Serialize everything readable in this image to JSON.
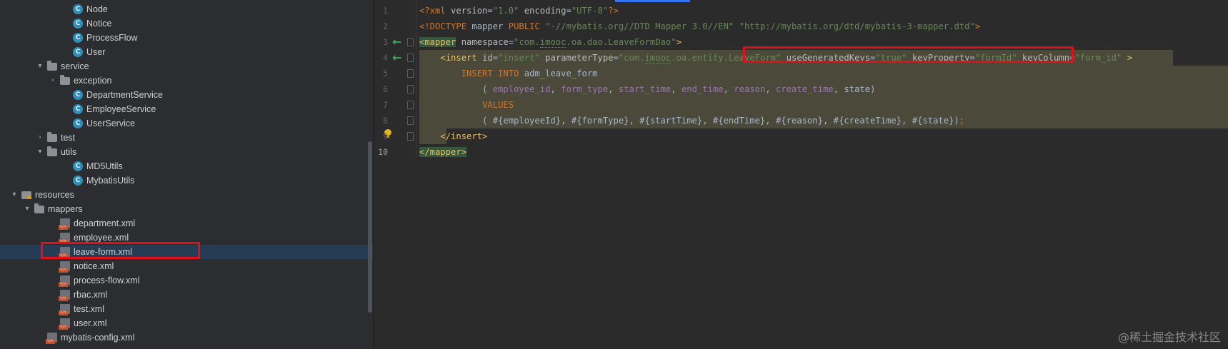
{
  "tree": {
    "items": [
      {
        "label": "Node",
        "type": "class",
        "indent": 5
      },
      {
        "label": "Notice",
        "type": "class",
        "indent": 5
      },
      {
        "label": "ProcessFlow",
        "type": "class",
        "indent": 5
      },
      {
        "label": "User",
        "type": "class",
        "indent": 5
      },
      {
        "label": "service",
        "type": "folder",
        "indent": 3,
        "expanded": true
      },
      {
        "label": "exception",
        "type": "folder",
        "indent": 4,
        "expanded": false
      },
      {
        "label": "DepartmentService",
        "type": "class",
        "indent": 5
      },
      {
        "label": "EmployeeService",
        "type": "class",
        "indent": 5
      },
      {
        "label": "UserService",
        "type": "class",
        "indent": 5
      },
      {
        "label": "test",
        "type": "folder",
        "indent": 3,
        "expanded": false
      },
      {
        "label": "utils",
        "type": "folder",
        "indent": 3,
        "expanded": true
      },
      {
        "label": "MD5Utils",
        "type": "class",
        "indent": 5
      },
      {
        "label": "MybatisUtils",
        "type": "class",
        "indent": 5
      },
      {
        "label": "resources",
        "type": "resfolder",
        "indent": 1,
        "expanded": true
      },
      {
        "label": "mappers",
        "type": "folder",
        "indent": 2,
        "expanded": true
      },
      {
        "label": "department.xml",
        "type": "xml",
        "indent": 4
      },
      {
        "label": "employee.xml",
        "type": "xml",
        "indent": 4
      },
      {
        "label": "leave-form.xml",
        "type": "xml",
        "indent": 4,
        "selected": true
      },
      {
        "label": "notice.xml",
        "type": "xml",
        "indent": 4
      },
      {
        "label": "process-flow.xml",
        "type": "xml",
        "indent": 4
      },
      {
        "label": "rbac.xml",
        "type": "xml",
        "indent": 4
      },
      {
        "label": "test.xml",
        "type": "xml",
        "indent": 4
      },
      {
        "label": "user.xml",
        "type": "xml",
        "indent": 4
      },
      {
        "label": "mybatis-config.xml",
        "type": "xml",
        "indent": 3
      }
    ]
  },
  "editor": {
    "line_numbers": [
      "1",
      "2",
      "3",
      "4",
      "5",
      "6",
      "7",
      "8",
      "9",
      "10"
    ],
    "current_line": "10",
    "lines": [
      [
        [
          "t-pi",
          "<?xml "
        ],
        [
          "t-attr",
          "version"
        ],
        [
          "t-plain",
          "="
        ],
        [
          "t-str",
          "\"1.0\""
        ],
        [
          "t-plain",
          " "
        ],
        [
          "t-attr",
          "encoding"
        ],
        [
          "t-plain",
          "="
        ],
        [
          "t-str",
          "\"UTF-8\""
        ],
        [
          "t-pi",
          "?>"
        ]
      ],
      [
        [
          "t-pi",
          "<!DOCTYPE "
        ],
        [
          "t-plain",
          "mapper "
        ],
        [
          "t-pi",
          "PUBLIC "
        ],
        [
          "t-str",
          "\"-//mybatis.org//DTD Mapper 3.0//EN\""
        ],
        [
          "t-plain",
          " "
        ],
        [
          "t-str",
          "\"http://mybatis.org/dtd/mybatis-3-mapper.dtd\""
        ],
        [
          "t-pi",
          ">"
        ]
      ],
      [
        [
          "t-tag t-hlt",
          "<mapper"
        ],
        [
          "t-plain",
          " "
        ],
        [
          "t-attr",
          "namespace"
        ],
        [
          "t-plain",
          "="
        ],
        [
          "t-str",
          "\"com."
        ],
        [
          "t-str ul-green",
          "imooc"
        ],
        [
          "t-str",
          ".oa.dao.LeaveFormDao\""
        ],
        [
          "t-tag",
          ">"
        ]
      ],
      [
        [
          "t-plain",
          "    "
        ],
        [
          "t-tag",
          "<insert "
        ],
        [
          "t-attr",
          "id"
        ],
        [
          "t-plain",
          "="
        ],
        [
          "t-str",
          "\"insert\""
        ],
        [
          "t-plain",
          " "
        ],
        [
          "t-attr",
          "parameterType"
        ],
        [
          "t-plain",
          "="
        ],
        [
          "t-str",
          "\"com."
        ],
        [
          "t-str ul-green",
          "imooc"
        ],
        [
          "t-str",
          ".oa.entity.LeaveForm\""
        ],
        [
          "t-plain",
          " "
        ],
        [
          "t-attr",
          "useGeneratedKeys"
        ],
        [
          "t-plain",
          "="
        ],
        [
          "t-str",
          "\"true\""
        ],
        [
          "t-plain",
          " "
        ],
        [
          "t-attr",
          "keyProperty"
        ],
        [
          "t-plain",
          "="
        ],
        [
          "t-str",
          "\"formId\""
        ],
        [
          "t-plain",
          " "
        ],
        [
          "t-attr",
          "keyColumn"
        ],
        [
          "t-plain",
          "="
        ],
        [
          "t-str",
          "\"form_id\""
        ],
        [
          "t-plain",
          " "
        ],
        [
          "t-tag",
          ">"
        ]
      ],
      [
        [
          "t-plain",
          "        "
        ],
        [
          "t-kw",
          "INSERT INTO "
        ],
        [
          "t-plain",
          "adm_leave_form"
        ]
      ],
      [
        [
          "t-plain",
          "            ( "
        ],
        [
          "t-col",
          "employee_id"
        ],
        [
          "t-plain",
          ", "
        ],
        [
          "t-col",
          "form_type"
        ],
        [
          "t-plain",
          ", "
        ],
        [
          "t-col",
          "start_time"
        ],
        [
          "t-plain",
          ", "
        ],
        [
          "t-col",
          "end_time"
        ],
        [
          "t-plain",
          ", "
        ],
        [
          "t-col",
          "reason"
        ],
        [
          "t-plain",
          ", "
        ],
        [
          "t-col",
          "create_time"
        ],
        [
          "t-plain",
          ", "
        ],
        [
          "t-plain",
          "state"
        ],
        [
          "t-plain",
          ")"
        ]
      ],
      [
        [
          "t-plain",
          "            "
        ],
        [
          "t-kw",
          "VALUES"
        ]
      ],
      [
        [
          "t-plain",
          "            ( #{employeeId}, #{formType}, #{startTime}, #{endTime}, #{reason}, #{createTime}, #{state})"
        ],
        [
          "t-kw",
          ";"
        ]
      ],
      [
        [
          "t-plain",
          "    "
        ],
        [
          "t-tag",
          "</insert>"
        ]
      ],
      [
        [
          "t-tag t-hlt",
          "</mapper>"
        ]
      ]
    ]
  },
  "watermark": "@稀土掘金技术社区"
}
